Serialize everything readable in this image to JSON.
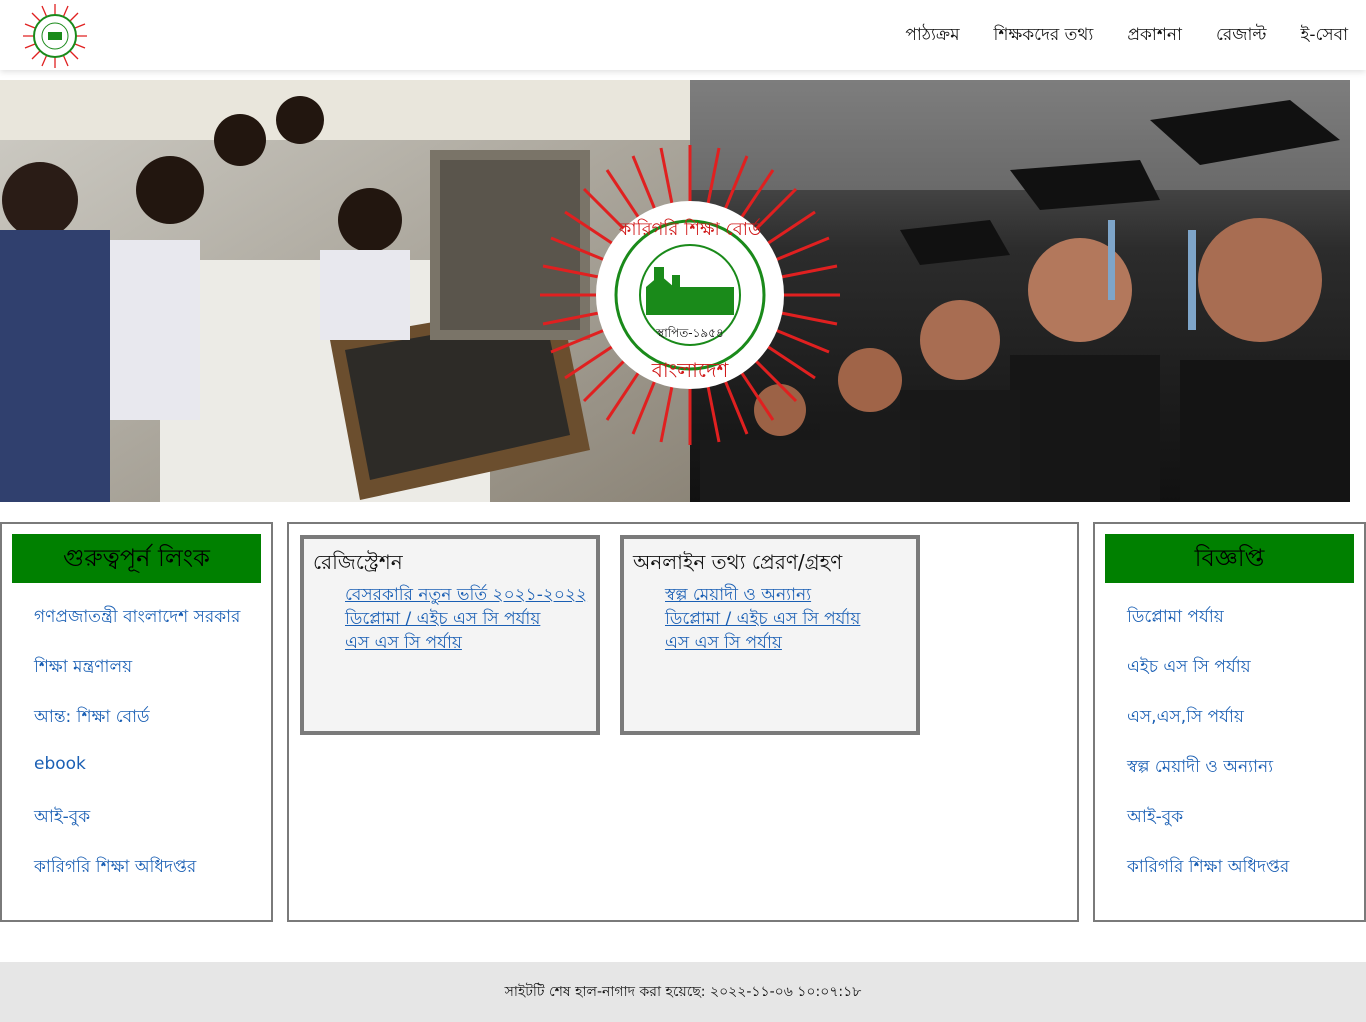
{
  "header": {
    "logo_icon": "board-seal-logo-icon",
    "nav": [
      {
        "label": "পাঠ্যক্রম"
      },
      {
        "label": "শিক্ষকদের তথ্য"
      },
      {
        "label": "প্রকাশনা"
      },
      {
        "label": "রেজাল্ট"
      },
      {
        "label": "ই-সেবা"
      }
    ]
  },
  "banner": {
    "seal_text_top": "কারিগরি শিক্ষা বোর্ড",
    "seal_text_est": "স্থাপিত-১৯৫৪",
    "seal_text_bottom": "বাংলাদেশ"
  },
  "important_links": {
    "title": "গুরুত্বপূর্ন লিংক",
    "items": [
      {
        "label": "গণপ্রজাতন্ত্রী বাংলাদেশ সরকার"
      },
      {
        "label": "শিক্ষা মন্ত্রণালয়"
      },
      {
        "label": "আন্ত: শিক্ষা বোর্ড"
      },
      {
        "label": "ebook"
      },
      {
        "label": "আই-বুক"
      },
      {
        "label": "কারিগরি শিক্ষা অধিদপ্তর"
      }
    ]
  },
  "registration": {
    "title": "রেজিস্ট্রেশন",
    "items": [
      {
        "label": "বেসরকারি নতুন ভর্তি ২০২১-২০২২"
      },
      {
        "label": "ডিপ্লোমা / এইচ এস সি পর্যায়"
      },
      {
        "label": "এস এস সি পর্যায়"
      }
    ]
  },
  "online_info": {
    "title": "অনলাইন তথ্য প্রেরণ/গ্রহণ",
    "items": [
      {
        "label": "স্বল্প মেয়াদী ও অন্যান্য"
      },
      {
        "label": "ডিপ্লোমা / এইচ এস সি পর্যায়"
      },
      {
        "label": "এস এস সি পর্যায়"
      }
    ]
  },
  "notices": {
    "title": "বিজ্ঞপ্তি",
    "items": [
      {
        "label": "ডিপ্লোমা পর্যায়"
      },
      {
        "label": "এইচ এস সি পর্যায়"
      },
      {
        "label": "এস,এস,সি পর্যায়"
      },
      {
        "label": "স্বল্প মেয়াদী ও অন্যান্য"
      },
      {
        "label": "আই-বুক"
      },
      {
        "label": "কারিগরি শিক্ষা অধিদপ্তর"
      }
    ]
  },
  "footer": {
    "text": "সাইটটি শেষ হাল-নাগাদ করা হয়েছে: ২০২২-১১-০৬ ১০:০৭:১৮"
  },
  "colors": {
    "accent_green": "#008000",
    "link_blue": "#1a5fb4",
    "seal_red": "#e02020"
  }
}
